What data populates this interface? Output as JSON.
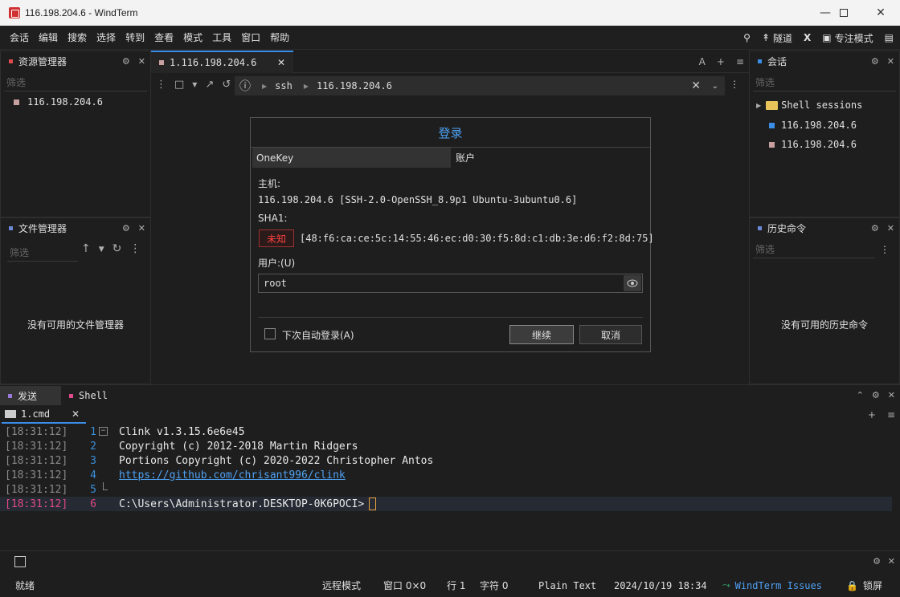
{
  "window": {
    "title": "116.198.204.6 - WindTerm"
  },
  "menu": {
    "items": [
      "会话",
      "编辑",
      "搜索",
      "选择",
      "转到",
      "查看",
      "模式",
      "工具",
      "窗口",
      "帮助"
    ],
    "tunnel": "隧道",
    "focus_mode": "专注模式"
  },
  "left_top": {
    "title": "资源管理器",
    "filter_placeholder": "筛选",
    "item": "116.198.204.6"
  },
  "left_bottom": {
    "title": "文件管理器",
    "filter_placeholder": "筛选",
    "empty": "没有可用的文件管理器"
  },
  "tab": {
    "label": "1.116.198.204.6"
  },
  "address": {
    "protocol": "ssh",
    "host": "116.198.204.6"
  },
  "dialog": {
    "title": "登录",
    "tab_onekey": "OneKey",
    "tab_account": "账户",
    "host_label": "主机:",
    "host_value": "116.198.204.6 [SSH-2.0-OpenSSH_8.9p1 Ubuntu-3ubuntu0.6]",
    "sha1_label": "SHA1:",
    "sha1_status": "未知",
    "sha1_value": "[48:f6:ca:ce:5c:14:55:46:ec:d0:30:f5:8d:c1:db:3e:d6:f2:8d:75]",
    "user_label": "用户:(U)",
    "user_value": "root",
    "auto_login": "下次自动登录(A)",
    "continue": "继续",
    "cancel": "取消"
  },
  "right_top": {
    "title": "会话",
    "filter_placeholder": "筛选",
    "folder": "Shell sessions",
    "sessions": [
      "116.198.204.6",
      "116.198.204.6"
    ]
  },
  "right_bottom": {
    "title": "历史命令",
    "filter_placeholder": "筛选",
    "empty": "没有可用的历史命令"
  },
  "bottom": {
    "tab_send": "发送",
    "tab_shell": "Shell",
    "cmd_tab": "1.cmd",
    "lines": [
      {
        "ts": "[18:31:12]",
        "n": "1",
        "text": "Clink v1.3.15.6e6e45"
      },
      {
        "ts": "[18:31:12]",
        "n": "2",
        "text": "Copyright (c) 2012-2018 Martin Ridgers"
      },
      {
        "ts": "[18:31:12]",
        "n": "3",
        "text": "Portions Copyright (c) 2020-2022 Christopher Antos"
      },
      {
        "ts": "[18:31:12]",
        "n": "4",
        "text": "https://github.com/chrisant996/clink"
      },
      {
        "ts": "[18:31:12]",
        "n": "5",
        "text": ""
      },
      {
        "ts": "[18:31:12]",
        "n": "6",
        "text": "C:\\Users\\Administrator.DESKTOP-0K6POCI>"
      }
    ]
  },
  "status": {
    "ready": "就绪",
    "remote_mode": "远程模式",
    "window": "窗口 0×0",
    "row": "行 1",
    "char": "字符 0",
    "syntax": "Plain Text",
    "datetime": "2024/10/19 18:34",
    "issues": "WindTerm Issues",
    "lock": "锁屏"
  },
  "colors": {
    "accent": "#3b8ee8",
    "link": "#4ea1f3",
    "alert": "#ff4040"
  }
}
